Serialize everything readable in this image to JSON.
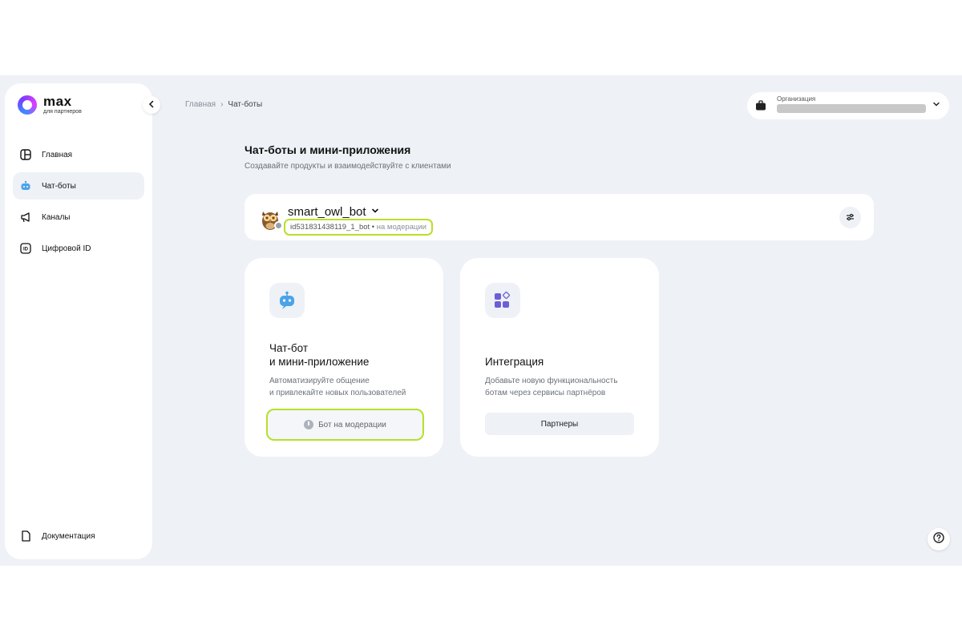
{
  "brand": {
    "name": "max",
    "sub": "для партнеров"
  },
  "sidebar": {
    "items": [
      {
        "label": "Главная",
        "icon": "home-icon"
      },
      {
        "label": "Чат-боты",
        "icon": "bot-icon",
        "active": true
      },
      {
        "label": "Каналы",
        "icon": "megaphone-icon"
      },
      {
        "label": "Цифровой ID",
        "icon": "id-icon"
      }
    ],
    "docs": {
      "label": "Документация",
      "icon": "document-icon"
    }
  },
  "breadcrumb": {
    "home": "Главная",
    "separator": "›",
    "current": "Чат-боты"
  },
  "org": {
    "label": "Организация"
  },
  "page": {
    "title": "Чат-боты и мини-приложения",
    "subtitle": "Создавайте продукты и взаимодействуйте с клиентами"
  },
  "bot": {
    "name": "smart_owl_bot",
    "id": "id531831438119_1_bot",
    "separator": "•",
    "status": "на модерации"
  },
  "cards": {
    "chatbot": {
      "title_line1": "Чат-бот",
      "title_line2": "и мини-приложение",
      "desc_line1": "Автоматизируйте общение",
      "desc_line2": "и привлекайте новых пользователей",
      "button": "Бот на модерации"
    },
    "integration": {
      "title": "Интеграция",
      "desc_line1": "Добавьте новую функциональность",
      "desc_line2": "ботам через сервисы партнёров",
      "button": "Партнеры"
    }
  },
  "colors": {
    "accent": "#b7e02a",
    "background": "#eef1f6",
    "brand": "#7a3cff"
  }
}
